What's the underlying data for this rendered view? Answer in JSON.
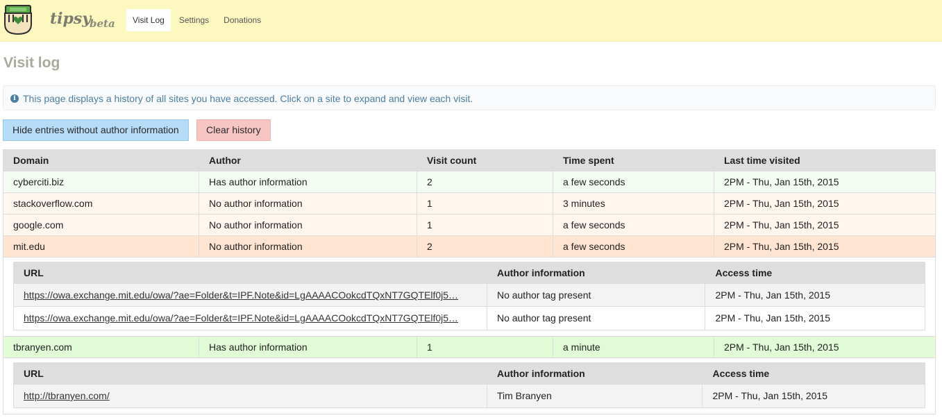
{
  "app": {
    "name": "tipsy",
    "badge": "beta"
  },
  "nav": [
    {
      "label": "Visit Log",
      "active": true
    },
    {
      "label": "Settings",
      "active": false
    },
    {
      "label": "Donations",
      "active": false
    }
  ],
  "page": {
    "title": "Visit log",
    "info": "This page displays a history of all sites you have accessed. Click on a site to expand and view each visit.",
    "hide_button": "Hide entries without author information",
    "clear_button": "Clear history"
  },
  "table": {
    "headers": [
      "Domain",
      "Author",
      "Visit count",
      "Time spent",
      "Last time visited"
    ],
    "rows": [
      [
        "cyberciti.biz",
        "Has author information",
        "2",
        "a few seconds",
        "2PM - Thu, Jan 15th, 2015"
      ],
      [
        "stackoverflow.com",
        "No author information",
        "1",
        "3 minutes",
        "2PM - Thu, Jan 15th, 2015"
      ],
      [
        "google.com",
        "No author information",
        "1",
        "a few seconds",
        "2PM - Thu, Jan 15th, 2015"
      ],
      [
        "mit.edu",
        "No author information",
        "2",
        "a few seconds",
        "2PM - Thu, Jan 15th, 2015"
      ],
      [
        "tbranyen.com",
        "Has author information",
        "1",
        "a minute",
        "2PM - Thu, Jan 15th, 2015"
      ]
    ]
  },
  "detail_headers": [
    "URL",
    "Author information",
    "Access time"
  ],
  "mit_visits": [
    [
      "https://owa.exchange.mit.edu/owa/?ae=Folder&t=IPF.Note&id=LgAAAACOokcdTQxNT7GQTElf0j5…",
      "No author tag present",
      "2PM - Thu, Jan 15th, 2015"
    ],
    [
      "https://owa.exchange.mit.edu/owa/?ae=Folder&t=IPF.Note&id=LgAAAACOokcdTQxNT7GQTElf0j5…",
      "No author tag present",
      "2PM - Thu, Jan 15th, 2015"
    ]
  ],
  "tbranyen_visits": [
    [
      "http://tbranyen.com/",
      "Tim Branyen",
      "2PM - Thu, Jan 15th, 2015"
    ]
  ],
  "colors": {
    "header_bg": "#fcf8c0",
    "has_author": "#e1fbd7",
    "no_author": "#fff6ee",
    "expanded_no_author": "#ffe4d2",
    "info_text": "#4c7ea0"
  }
}
